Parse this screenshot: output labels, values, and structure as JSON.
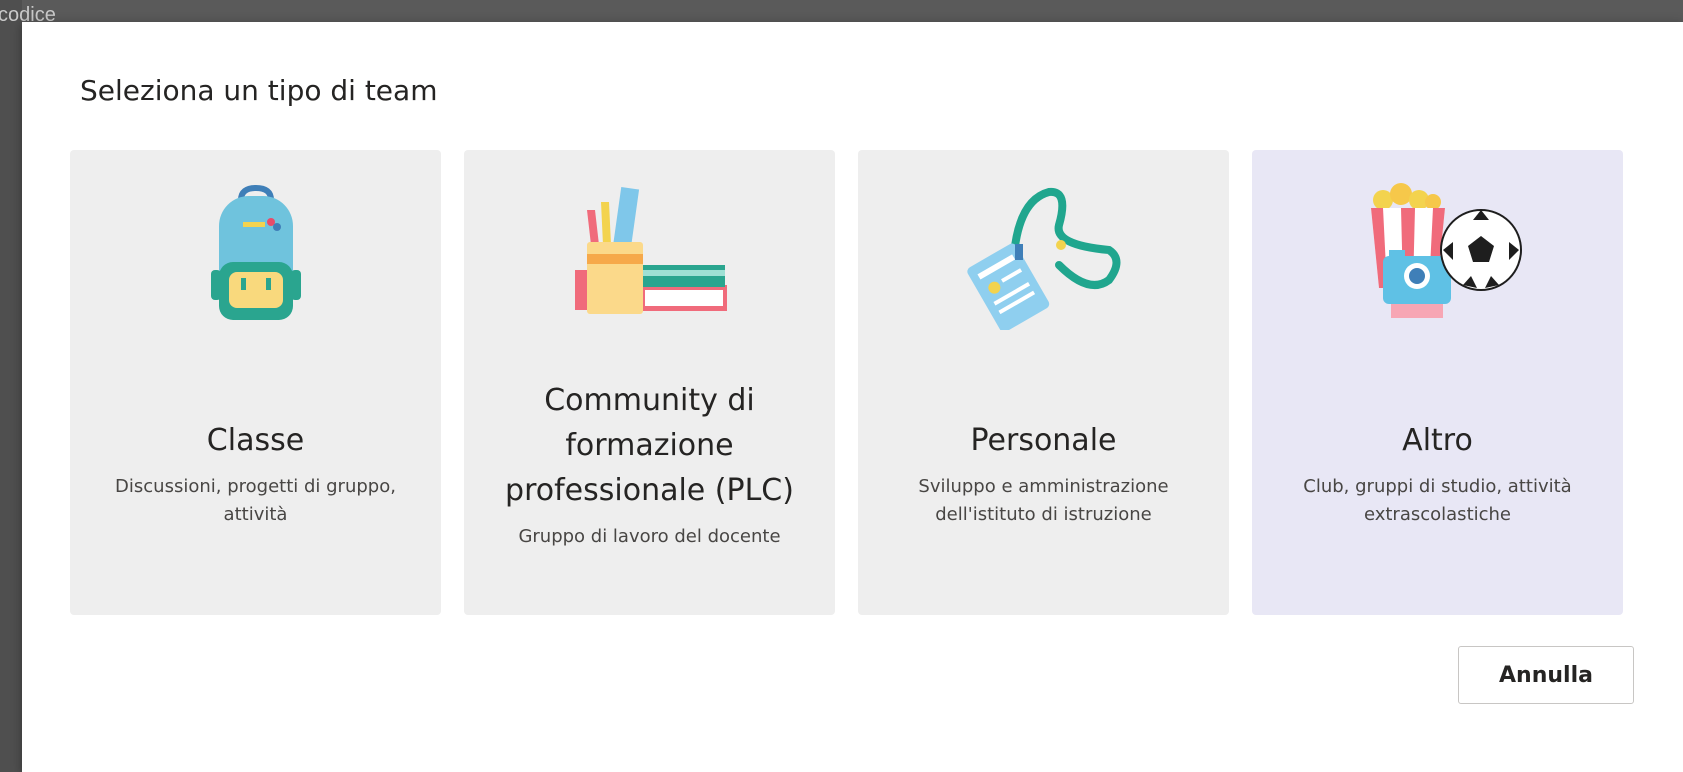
{
  "background": {
    "partial_text": "codice"
  },
  "dialog": {
    "title": "Seleziona un tipo di team",
    "cards": [
      {
        "title": "Classe",
        "description": "Discussioni, progetti di gruppo, attività",
        "icon": "backpack-icon",
        "selected": false
      },
      {
        "title": "Community di formazione professionale (PLC)",
        "description": "Gruppo di lavoro del docente",
        "icon": "pencil-cup-books-icon",
        "selected": false
      },
      {
        "title": "Personale",
        "description": "Sviluppo e amministrazione dell'istituto di istruzione",
        "icon": "id-badge-lanyard-icon",
        "selected": false
      },
      {
        "title": "Altro",
        "description": "Club, gruppi di studio, attività extrascolastiche",
        "icon": "popcorn-camera-soccer-icon",
        "selected": true
      }
    ],
    "cancel_label": "Annulla"
  },
  "colors": {
    "card_bg": "#eeeeee",
    "card_selected_bg": "#e8e7f5",
    "dialog_bg": "#ffffff",
    "backdrop": "#5a5a5a"
  }
}
